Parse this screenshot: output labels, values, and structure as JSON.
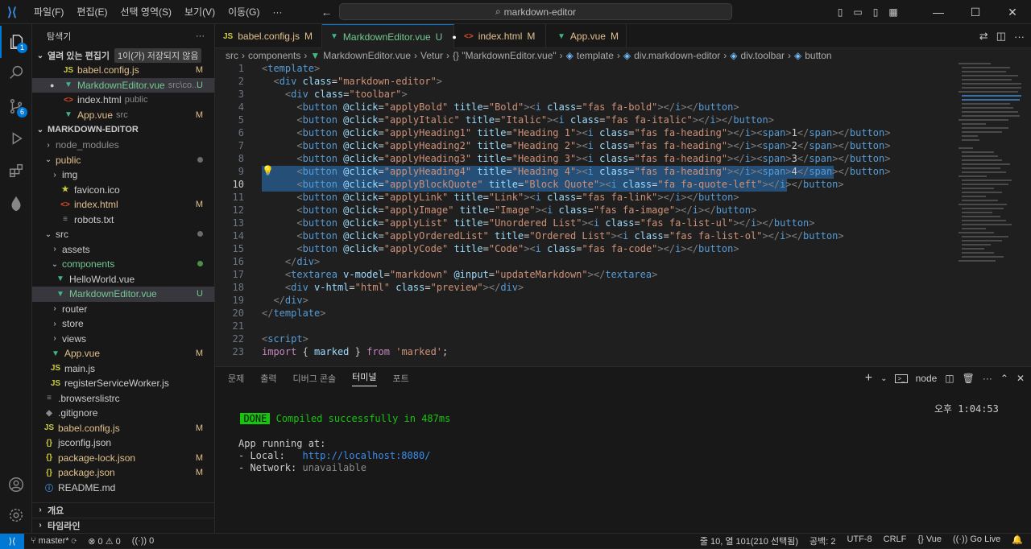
{
  "menu": {
    "items": [
      "파일(F)",
      "편집(E)",
      "선택 영역(S)",
      "보기(V)",
      "이동(G)",
      "···"
    ],
    "search": "markdown-editor"
  },
  "activity": {
    "explorer_badge": "1",
    "scm_badge": "6"
  },
  "sidebar": {
    "title": "탐색기",
    "more": "···",
    "open_editors": "열려 있는 편집기",
    "unsaved": "1이(가) 저장되지 않음",
    "open_files": [
      {
        "name": "babel.config.js",
        "hint": "",
        "status": "M"
      },
      {
        "name": "MarkdownEditor.vue",
        "hint": "src\\co...",
        "status": "U"
      },
      {
        "name": "index.html",
        "hint": "public",
        "status": ""
      },
      {
        "name": "App.vue",
        "hint": "src",
        "status": "M"
      }
    ],
    "project": "MARKDOWN-EDITOR",
    "tree": [
      {
        "name": "node_modules",
        "status": ""
      },
      {
        "name": "public",
        "status": ""
      },
      {
        "name": "img",
        "status": ""
      },
      {
        "name": "favicon.ico",
        "status": ""
      },
      {
        "name": "index.html",
        "status": "M"
      },
      {
        "name": "robots.txt",
        "status": ""
      },
      {
        "name": "src",
        "status": ""
      },
      {
        "name": "assets",
        "status": ""
      },
      {
        "name": "components",
        "status": ""
      },
      {
        "name": "HelloWorld.vue",
        "status": ""
      },
      {
        "name": "MarkdownEditor.vue",
        "status": "U"
      },
      {
        "name": "router",
        "status": ""
      },
      {
        "name": "store",
        "status": ""
      },
      {
        "name": "views",
        "status": ""
      },
      {
        "name": "App.vue",
        "status": "M"
      },
      {
        "name": "main.js",
        "status": ""
      },
      {
        "name": "registerServiceWorker.js",
        "status": ""
      },
      {
        "name": ".browserslistrc",
        "status": ""
      },
      {
        "name": ".gitignore",
        "status": ""
      },
      {
        "name": "babel.config.js",
        "status": "M"
      },
      {
        "name": "jsconfig.json",
        "status": ""
      },
      {
        "name": "package-lock.json",
        "status": "M"
      },
      {
        "name": "package.json",
        "status": "M"
      },
      {
        "name": "README.md",
        "status": ""
      }
    ],
    "outline": "개요",
    "timeline": "타임라인"
  },
  "tabs": [
    {
      "name": "babel.config.js",
      "status": "M"
    },
    {
      "name": "MarkdownEditor.vue",
      "status": "U"
    },
    {
      "name": "index.html",
      "status": "M"
    },
    {
      "name": "App.vue",
      "status": "M"
    }
  ],
  "breadcrumb": [
    "src",
    "components",
    "MarkdownEditor.vue",
    "Vetur",
    "{} \"MarkdownEditor.vue\"",
    "template",
    "div.markdown-editor",
    "div.toolbar",
    "button"
  ],
  "editor": {
    "line_numbers": [
      "1",
      "2",
      "3",
      "4",
      "5",
      "6",
      "7",
      "8",
      "9",
      "10",
      "11",
      "12",
      "13",
      "14",
      "15",
      "16",
      "17",
      "18",
      "19",
      "20",
      "21",
      "22",
      "23"
    ],
    "current_line": "10"
  },
  "panel": {
    "tabs": [
      "문제",
      "출력",
      "디버그 콘솔",
      "터미널",
      "포트"
    ],
    "active_tab": "터미널",
    "shell": "node",
    "done": "DONE",
    "compiled": "Compiled successfully in 487ms",
    "time": "오후 1:04:53",
    "app_running": "App running at:",
    "local_label": "- Local:   ",
    "local_url": "http://localhost:8080/",
    "network_label": "- Network: ",
    "network_value": "unavailable"
  },
  "status": {
    "branch": "master*",
    "errors": "0",
    "warnings": "0",
    "ports": "0",
    "position": "줄 10, 열 101(210 선택됨)",
    "spaces": "공백: 2",
    "encoding": "UTF-8",
    "eol": "CRLF",
    "language": "Vue",
    "golive": "Go Live"
  },
  "colors": {
    "accent": "#0078d4",
    "modified": "#e2c08d",
    "untracked": "#73c991",
    "vue": "#41b883",
    "html": "#e44d26",
    "js": "#cbcb41",
    "json": "#cbcb41"
  }
}
